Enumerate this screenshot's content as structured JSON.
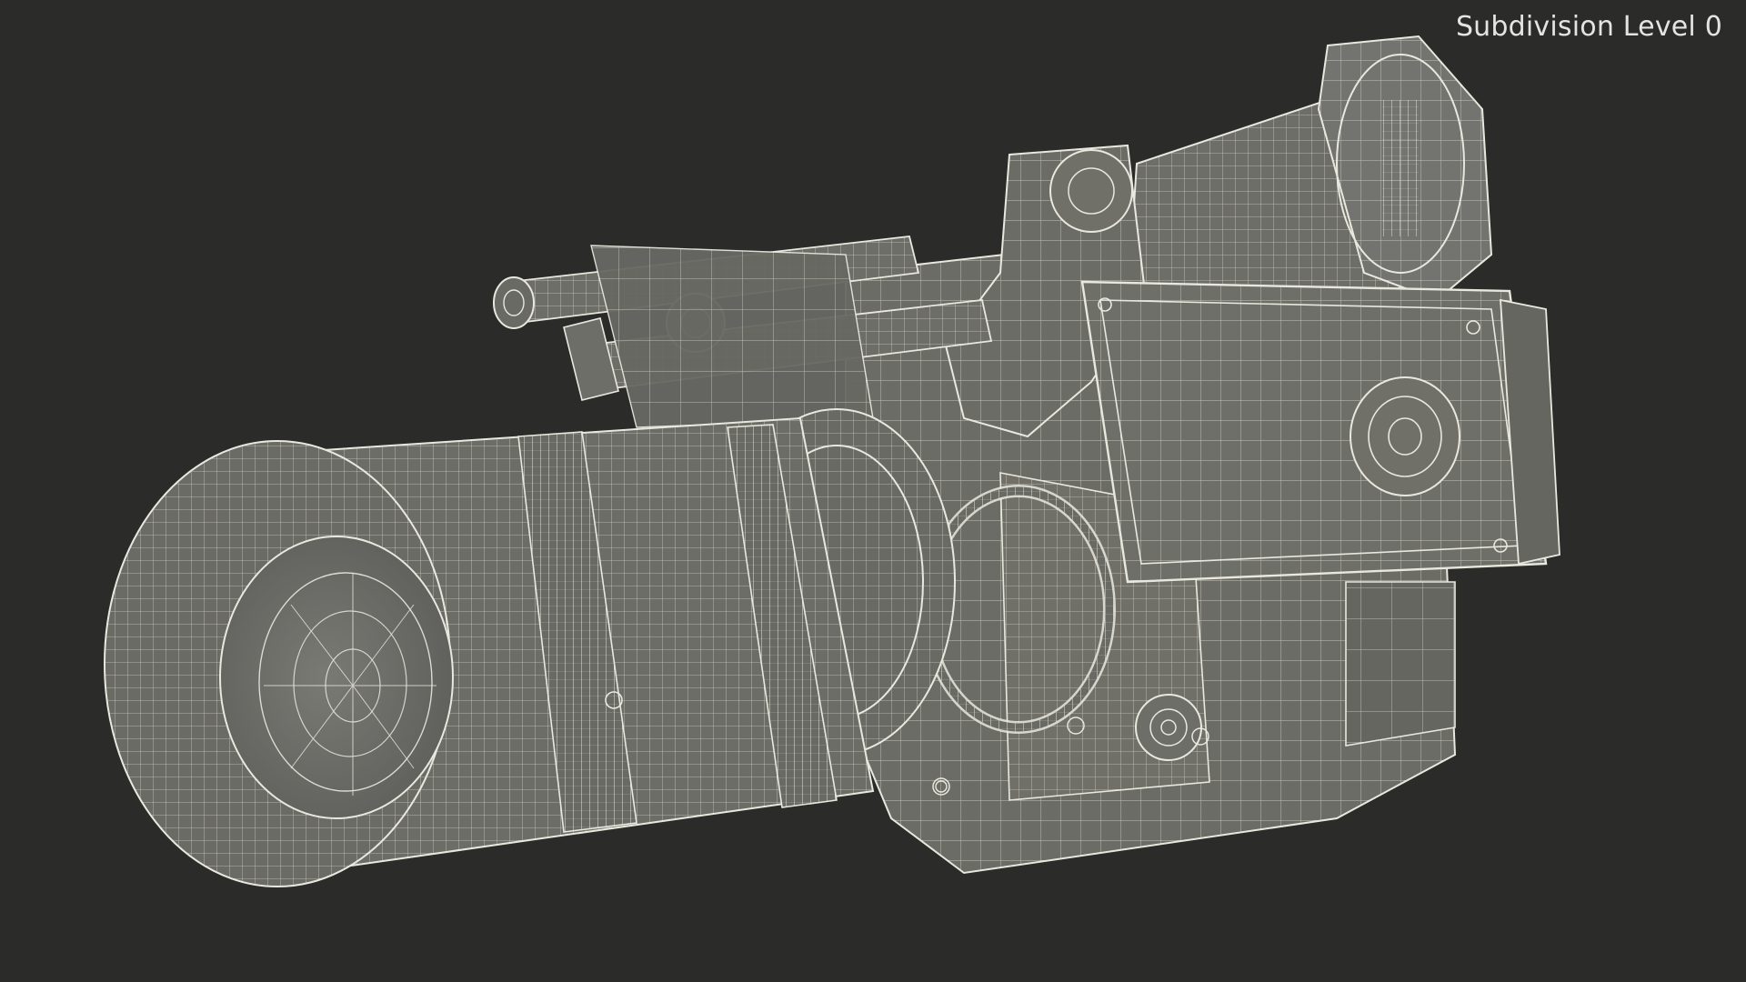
{
  "viewport": {
    "label": "Subdivision Level 0",
    "background_color": "#2b2b29",
    "surface_color": "#6e6e69",
    "wire_color": "#e9e8de",
    "render_style": "wireframe-on-shaded",
    "subject": "cinema-camera-3d-model"
  }
}
